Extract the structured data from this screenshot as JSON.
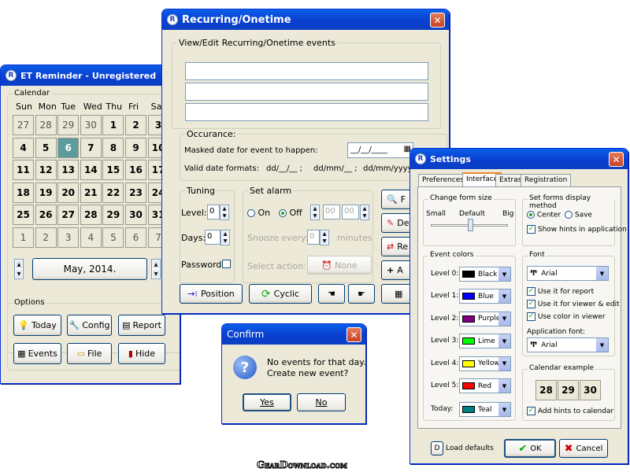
{
  "et": {
    "title": "ET Reminder - Unregistered",
    "calendar_label": "Calendar",
    "days": [
      "Sun",
      "Mon",
      "Tue",
      "Wed",
      "Thu",
      "Fri",
      "Sat"
    ],
    "weeks": [
      [
        "27",
        "28",
        "29",
        "30",
        "1",
        "2",
        "3"
      ],
      [
        "4",
        "5",
        "6",
        "7",
        "8",
        "9",
        "10"
      ],
      [
        "11",
        "12",
        "13",
        "14",
        "15",
        "16",
        "17"
      ],
      [
        "18",
        "19",
        "20",
        "21",
        "22",
        "23",
        "24"
      ],
      [
        "25",
        "26",
        "27",
        "28",
        "29",
        "30",
        "31"
      ],
      [
        "1",
        "2",
        "3",
        "4",
        "5",
        "6",
        "7"
      ]
    ],
    "month": "May, 2014.",
    "options_label": "Options",
    "today": "Today",
    "config": "Config",
    "report": "Report",
    "events": "Events",
    "file": "File",
    "hide": "Hide"
  },
  "rec": {
    "title": "Recurring/Onetime",
    "view_label": "View/Edit Recurring/Onetime events",
    "occ_label": "Occurance:",
    "masked_label": "Masked date for event to happen:",
    "masked_value": "__/__/____",
    "formats_label": "Valid date formats:",
    "fmt1": "dd/__/__ ;",
    "fmt2": "dd/mm/__ ;",
    "fmt3": "dd/mm/yyyy",
    "tuning_label": "Tuning",
    "level_label": "Level:",
    "level_value": "0",
    "days_label": "Days:",
    "days_value": "0",
    "password_label": "Password",
    "alarm_label": "Set alarm",
    "on": "On",
    "off": "Off",
    "h": "00",
    "m": "00",
    "snooze_label": "Snooze every:",
    "snooze_value": "0",
    "minutes": "minutes",
    "action_label": "Select action:",
    "none": "None",
    "position": "Position",
    "cyclic": "Cyclic",
    "btn_f": "F",
    "btn_de": "De",
    "btn_re": "Re",
    "btn_a": "A"
  },
  "confirm": {
    "title": "Confirm",
    "line1": "No events for that day.",
    "line2": "Create new event?",
    "yes": "Yes",
    "no": "No"
  },
  "settings": {
    "title": "Settings",
    "tabs": [
      "Preferences",
      "Interface",
      "Extras",
      "Registration"
    ],
    "form_size": "Change form size",
    "small": "Small",
    "default": "Default",
    "big": "Big",
    "display_method": "Set forms display method",
    "center": "Center",
    "save": "Save",
    "hints": "Show hints in application",
    "event_colors": "Event colors",
    "levels": [
      {
        "label": "Level 0:",
        "color": "Black",
        "hex": "#000000"
      },
      {
        "label": "Level 1:",
        "color": "Blue",
        "hex": "#0000ff"
      },
      {
        "label": "Level 2:",
        "color": "Purple",
        "hex": "#800080"
      },
      {
        "label": "Level 3:",
        "color": "Lime",
        "hex": "#00ff00"
      },
      {
        "label": "Level 4:",
        "color": "Yellow",
        "hex": "#ffff00"
      },
      {
        "label": "Level 5:",
        "color": "Red",
        "hex": "#ff0000"
      },
      {
        "label": "Today:",
        "color": "Teal",
        "hex": "#008080"
      }
    ],
    "font": "Font",
    "font_value": "Arial",
    "use_report": "Use it for report",
    "use_viewer": "Use it for viewer & edit",
    "use_color": "Use color in viewer",
    "app_font": "Application font:",
    "app_font_value": "Arial",
    "cal_example": "Calendar example",
    "ex": [
      "28",
      "29",
      "30"
    ],
    "add_hints": "Add hints to calendar",
    "load_defaults": "Load defaults",
    "ok": "OK",
    "cancel": "Cancel"
  },
  "watermark": "GearDownload.com"
}
